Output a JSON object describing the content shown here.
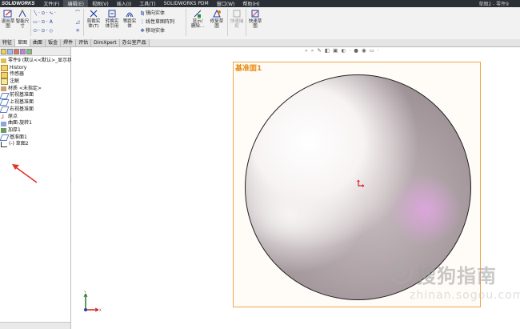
{
  "app": {
    "logo": "SOLIDWORKS"
  },
  "menubar": {
    "items": [
      "文件(F)",
      "编辑(E)",
      "视图(V)",
      "插入(I)",
      "工具(T)",
      "SOLIDWORKS PDM",
      "窗口(W)",
      "帮助(H)"
    ],
    "doc_title": "草图2 - 零件9"
  },
  "toolbar": {
    "exit_sketch": "退出草\n图",
    "smart_dim": "智能尺\n寸",
    "trim": "剪裁实\n体(T)",
    "convert": "转换实\n体引用",
    "offset": "等距实\n体",
    "mirror": "镜向实体",
    "linear_pattern": "线性草图阵列",
    "move": "移动实体",
    "display_delete": "显示/\n删除...",
    "repair": "修复草\n图",
    "quick_snaps": "快速捕\n捉",
    "rapid_sketch": "快速草\n图"
  },
  "tabs": [
    "特征",
    "草图",
    "曲面",
    "钣金",
    "焊件",
    "评估",
    "DimXpert",
    "办公室产品"
  ],
  "tree": {
    "root": "零件9 (默认<<默认>_显示状",
    "items": [
      "History",
      "传感器",
      "注解",
      "材质 <未指定>",
      "前视基准面",
      "上视基准面",
      "右视基准面",
      "原点",
      "曲面-旋转1",
      "加厚1",
      "基准面1",
      "(-) 草图2"
    ]
  },
  "viewport": {
    "hud_icons": "⌕ ⌕ ✎ ◧ ▣ ◐ · ● ◉ ▭ ·",
    "plane_label": "基准面1"
  },
  "watermark": {
    "brand": "搜狗指南",
    "url": "zhinan.sogou.com"
  },
  "colors": {
    "plane_border": "#f0a54a",
    "plane_label": "#e58a14",
    "annotation_arrow": "#e0342c"
  }
}
